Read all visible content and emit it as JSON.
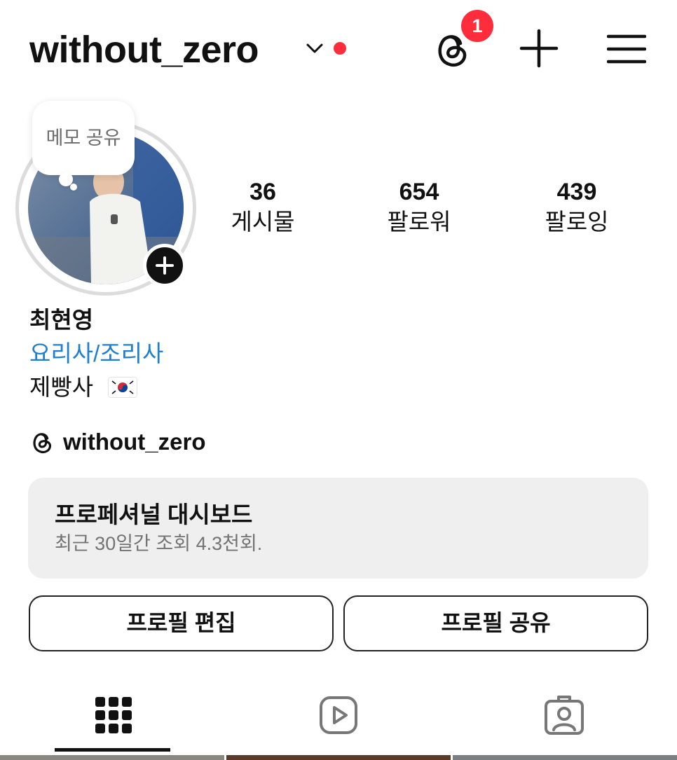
{
  "header": {
    "username": "without_zero",
    "threads_badge": "1"
  },
  "profile": {
    "memo_label": "메모 공유",
    "stats": [
      {
        "value": "36",
        "label": "게시물"
      },
      {
        "value": "654",
        "label": "팔로워"
      },
      {
        "value": "439",
        "label": "팔로잉"
      }
    ],
    "name": "최현영",
    "category": "요리사/조리사",
    "bio": "제빵사",
    "threads_handle": "without_zero"
  },
  "dashboard": {
    "title": "프로페셔널 대시보드",
    "subtitle": "최근 30일간 조회 4.3천회."
  },
  "buttons": {
    "edit": "프로필 편집",
    "share": "프로필 공유"
  },
  "colors": {
    "badge": "#ff2d3b",
    "link": "#1e7fd1",
    "dashboard_bg": "#efefef"
  },
  "icons": [
    "chevron-down-icon",
    "threads-icon",
    "plus-icon",
    "menu-icon",
    "grid-icon",
    "reels-icon",
    "tagged-icon",
    "korea-flag-icon"
  ]
}
